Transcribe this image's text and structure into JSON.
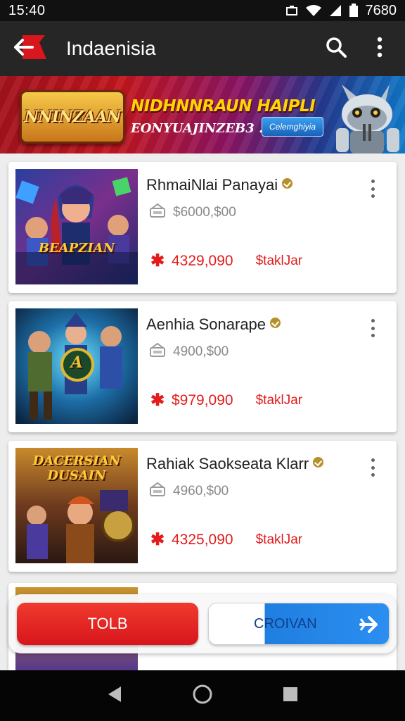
{
  "status_bar": {
    "time": "15:40",
    "battery": "7680"
  },
  "app_bar": {
    "title": "Indaenisia"
  },
  "banner": {
    "logo_text": "NNINZAAN",
    "headline": "NIDHNNRAUN HAIPLI",
    "subline": "EONYUAJINZEB3 .",
    "button_label": "Celemghiyia"
  },
  "listings": [
    {
      "title": "RhmaiNlai Panayai",
      "meta": "$6000,$00",
      "price": "4329,090",
      "tag": "$taklJar",
      "thumb_caption": "BEAPZIAN"
    },
    {
      "title": "Aenhia Sonarape",
      "meta": "4900,$00",
      "price": "$979,090",
      "tag": "$taklJar",
      "thumb_caption": "A"
    },
    {
      "title": "Rahiak Saokseata Klarr",
      "meta": "4960,$00",
      "price": "4325,090",
      "tag": "$taklJar",
      "thumb_caption": "DACERSIAN DUSAIN"
    }
  ],
  "bottom_actions": {
    "primary_label": "TOLB",
    "secondary_label": "CROIVAN"
  },
  "colors": {
    "accent_red": "#e31b1b",
    "accent_blue": "#1f7fe0",
    "app_bar": "#262626"
  }
}
